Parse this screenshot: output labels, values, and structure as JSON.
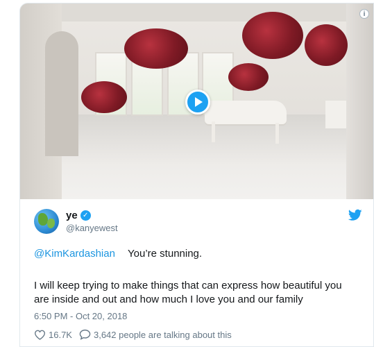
{
  "media": {
    "info_label": "i"
  },
  "tweet": {
    "name": "ye",
    "handle": "@kanyewest",
    "mention": "@KimKardashian",
    "reply_text": "You’re stunning.",
    "body_line1": "I will keep trying to make things that can express how beautiful you",
    "body_line2": "are inside and out and how much I love you and our family",
    "timestamp": "6:50 PM - Oct 20, 2018",
    "likes": "16.7K",
    "conversation": "3,642 people are talking about this"
  },
  "icons": {
    "play": "play-icon",
    "info": "info-icon",
    "verified": "verified-badge-icon",
    "brand": "twitter-bird-icon",
    "like": "heart-icon",
    "reply": "speech-bubble-icon"
  },
  "colors": {
    "accent": "#1da1f2",
    "link": "#1b95e0",
    "muted": "#657786",
    "text": "#14171a"
  }
}
